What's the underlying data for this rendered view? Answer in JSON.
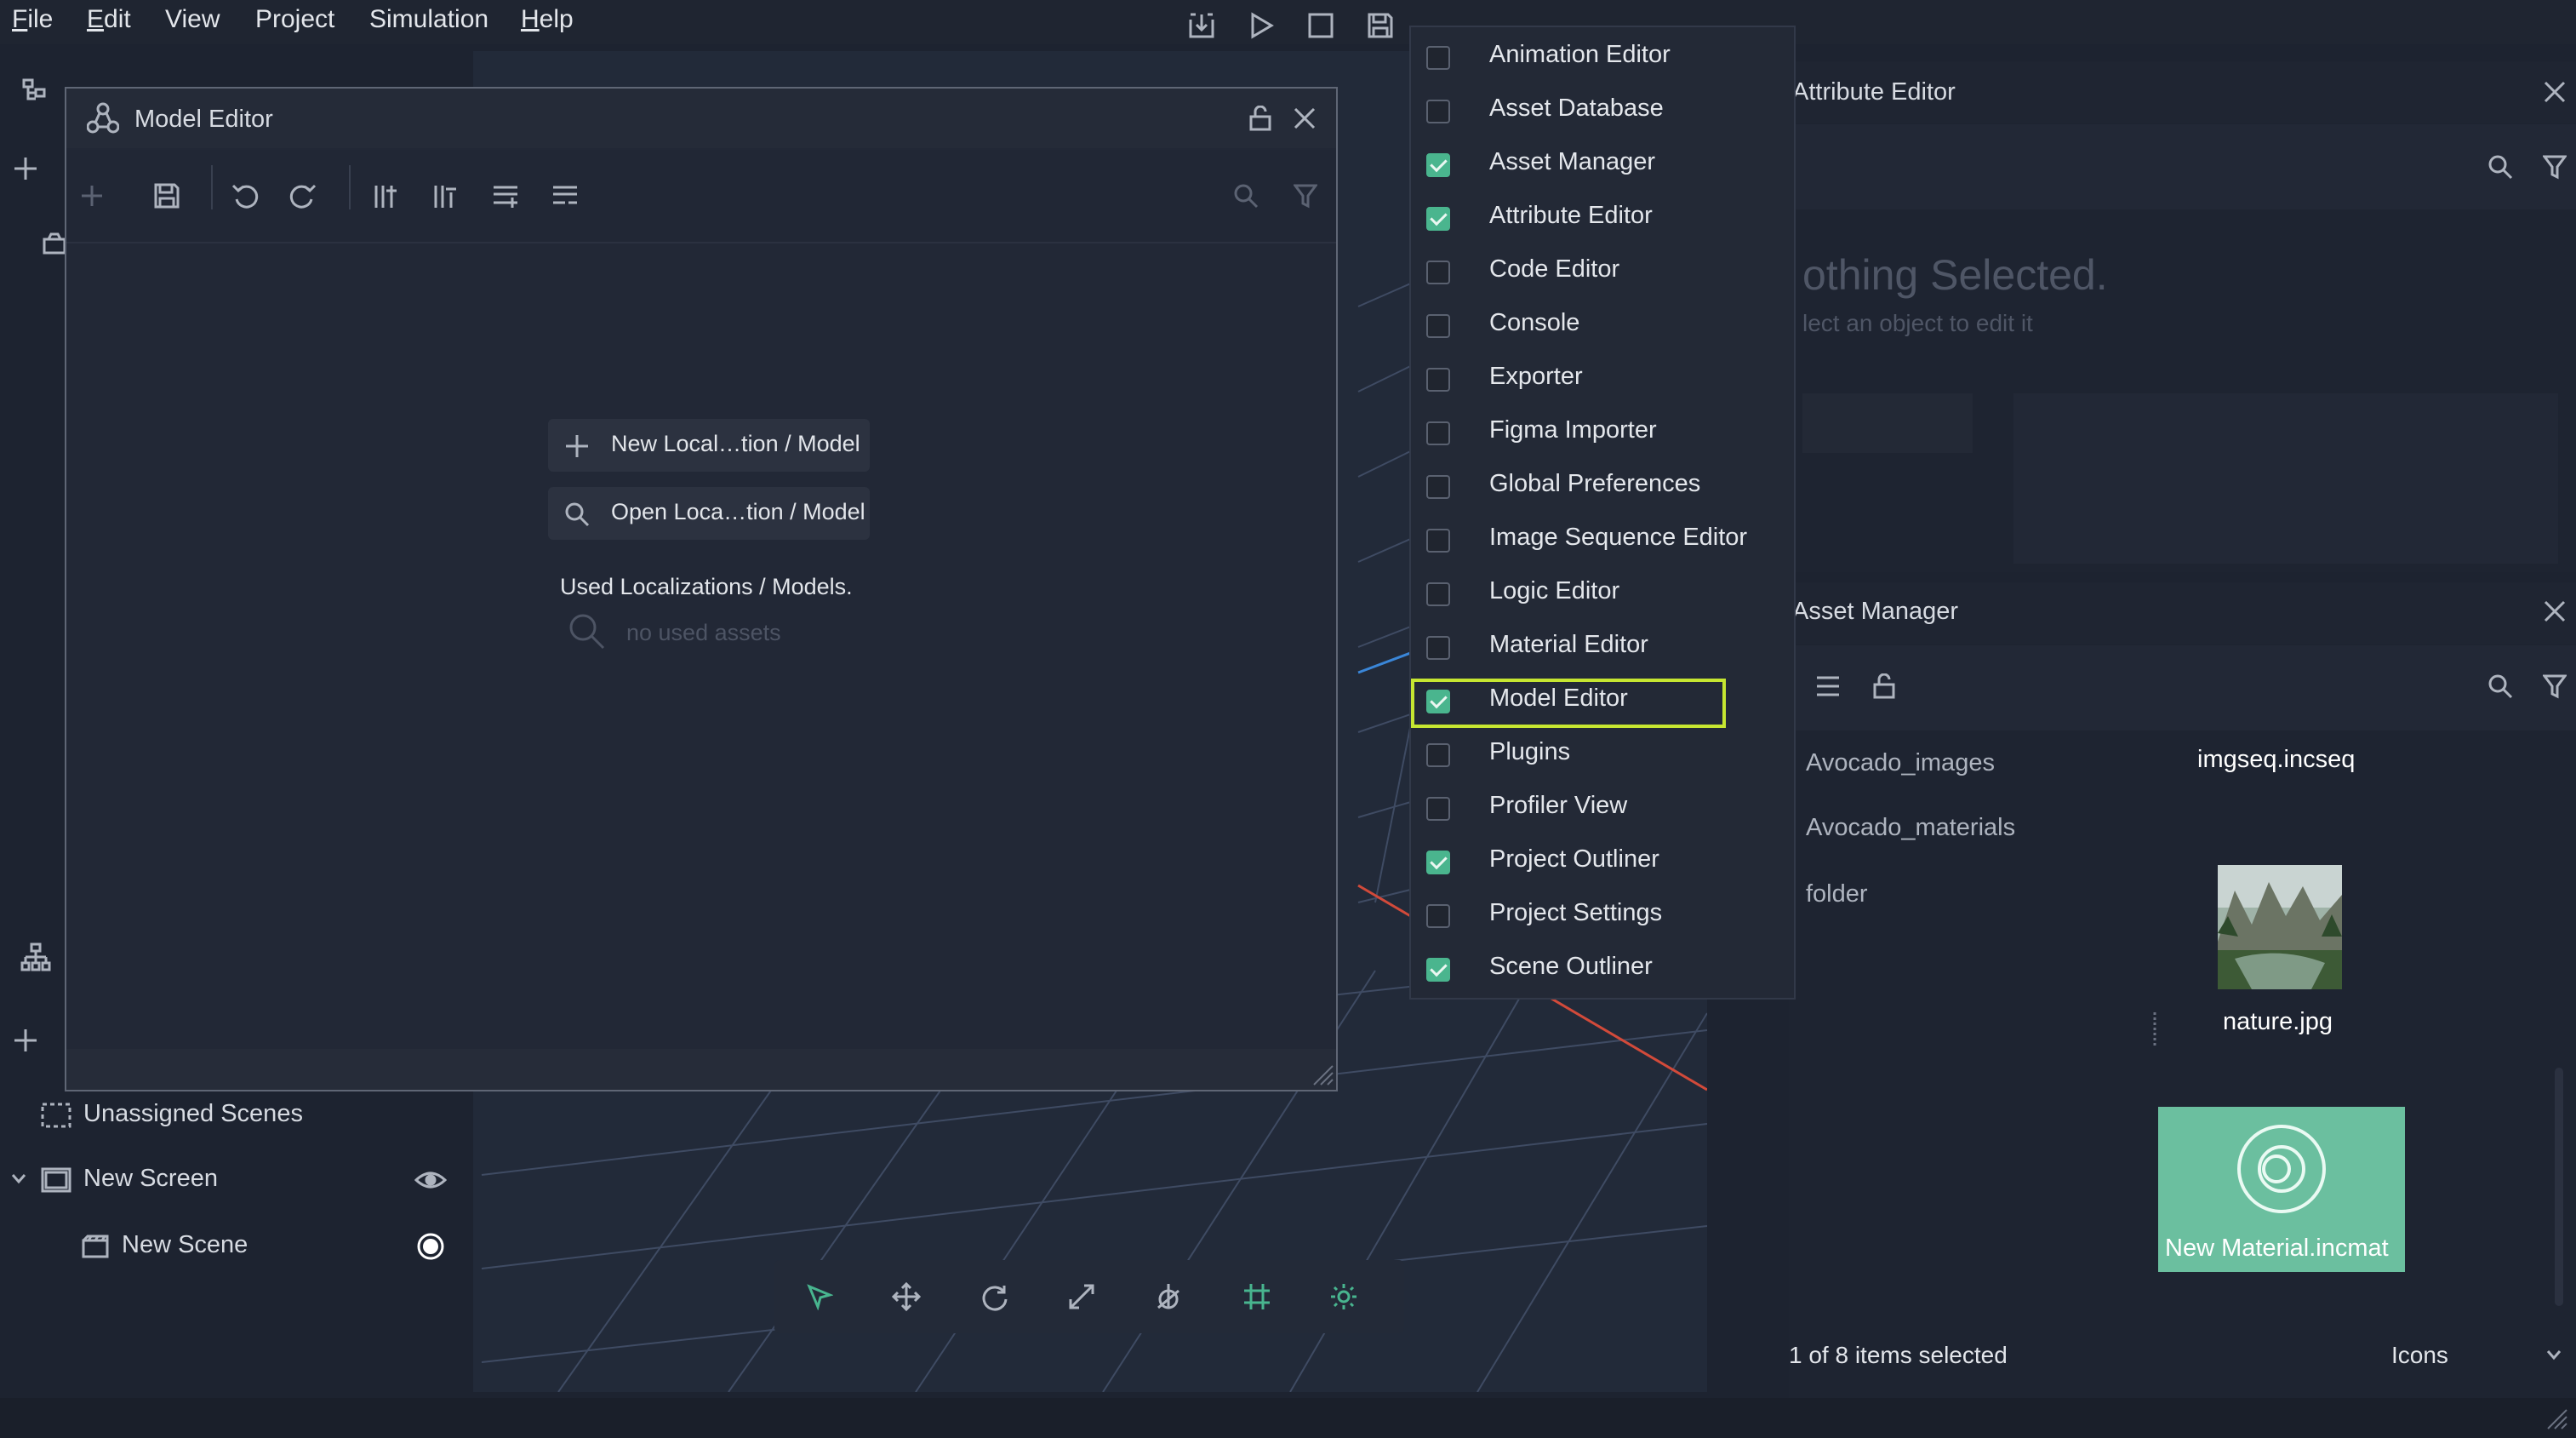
{
  "menubar": {
    "items": [
      "File",
      "Edit",
      "View",
      "Project",
      "Simulation",
      "Help"
    ]
  },
  "model_editor": {
    "title": "Model Editor",
    "new_button": "New Local…tion / Model",
    "open_button": "Open Loca…tion / Model",
    "used_heading": "Used Localizations / Models.",
    "no_assets": "no used assets"
  },
  "view_menu": {
    "items": [
      {
        "label": "Animation Editor",
        "checked": false
      },
      {
        "label": "Asset Database",
        "checked": false
      },
      {
        "label": "Asset Manager",
        "checked": true
      },
      {
        "label": "Attribute Editor",
        "checked": true
      },
      {
        "label": "Code Editor",
        "checked": false
      },
      {
        "label": "Console",
        "checked": false
      },
      {
        "label": "Exporter",
        "checked": false
      },
      {
        "label": "Figma Importer",
        "checked": false
      },
      {
        "label": "Global Preferences",
        "checked": false
      },
      {
        "label": "Image Sequence Editor",
        "checked": false
      },
      {
        "label": "Logic Editor",
        "checked": false
      },
      {
        "label": "Material Editor",
        "checked": false
      },
      {
        "label": "Model Editor",
        "checked": true
      },
      {
        "label": "Plugins",
        "checked": false
      },
      {
        "label": "Profiler View",
        "checked": false
      },
      {
        "label": "Project Outliner",
        "checked": true
      },
      {
        "label": "Project Settings",
        "checked": false
      },
      {
        "label": "Scene Outliner",
        "checked": true
      }
    ],
    "highlight_color": "#c6e631",
    "check_color": "#4ab58e"
  },
  "attribute_editor": {
    "title": "Attribute Editor",
    "nothing_selected": "othing Selected.",
    "hint": "lect an object to edit it"
  },
  "asset_manager": {
    "title": "Asset Manager",
    "folders": [
      "Avocado_images",
      "Avocado_materials",
      "folder"
    ],
    "files": [
      {
        "name": "imgseq.incseq"
      },
      {
        "name": "nature.jpg"
      },
      {
        "name": "New Material.incmat",
        "selected": true
      }
    ],
    "status": "1 of 8 items selected",
    "view_mode": "Icons"
  },
  "project_outliner": {
    "items": [
      {
        "label": "Unassigned Scenes"
      },
      {
        "label": "New Screen"
      },
      {
        "label": "New Scene"
      }
    ]
  },
  "colors": {
    "accent": "#48b58f",
    "background": "#1d2330"
  }
}
